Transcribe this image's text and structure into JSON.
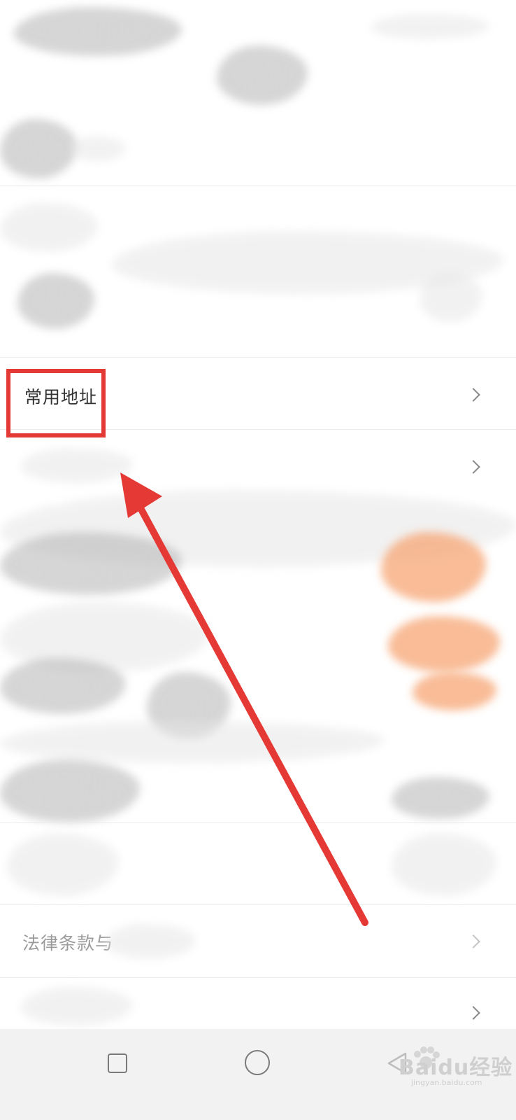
{
  "menu": {
    "items": [
      {
        "label": "常用地址"
      },
      {
        "label": "法律条款与"
      }
    ]
  },
  "watermark": {
    "text": "Baidu经验",
    "sub": "jingyan.baidu.com"
  },
  "colors": {
    "highlight": "#e53935",
    "arrow": "#e53935",
    "smudge_accent": "#f5894a",
    "nav_bar": "#f2f2f2"
  },
  "icons": [
    "chevron-right-icon",
    "recents-icon",
    "home-icon",
    "back-icon"
  ]
}
